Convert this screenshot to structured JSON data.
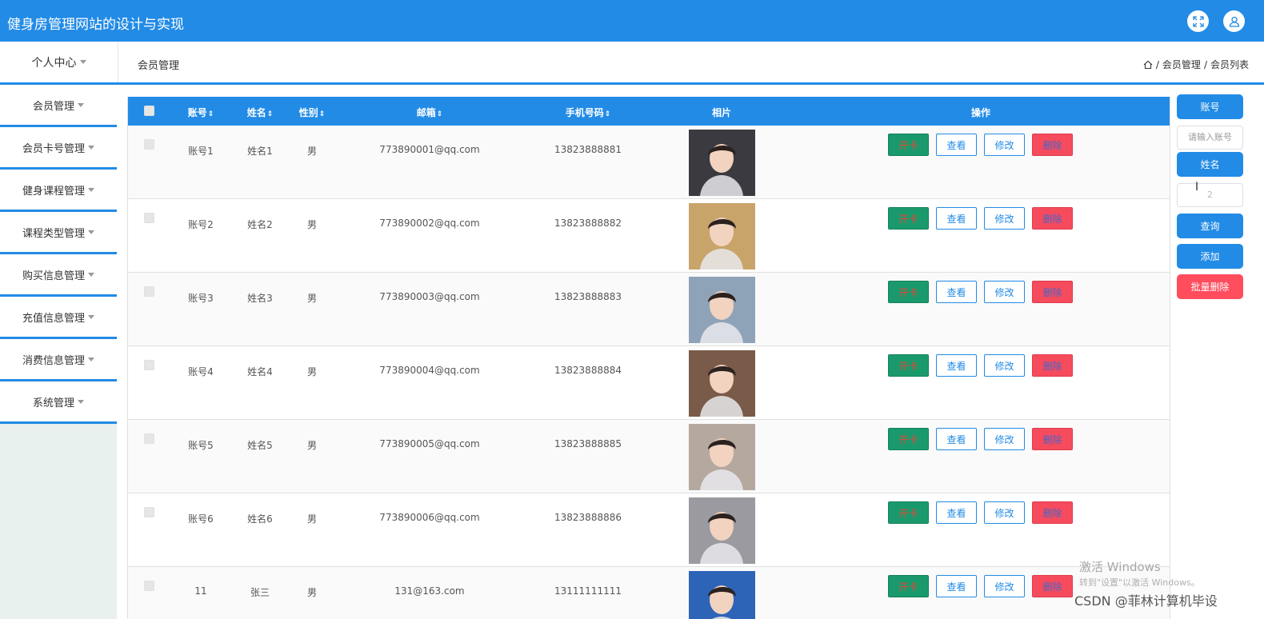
{
  "header": {
    "title": "健身房管理网站的设计与实现"
  },
  "nav": {
    "personal": "个人中心",
    "section": "会员管理",
    "breadcrumb": [
      "会员管理",
      "会员列表"
    ],
    "sep": "/"
  },
  "sidebar": {
    "items": [
      {
        "label": "会员管理"
      },
      {
        "label": "会员卡号管理"
      },
      {
        "label": "健身课程管理"
      },
      {
        "label": "课程类型管理"
      },
      {
        "label": "购买信息管理"
      },
      {
        "label": "充值信息管理"
      },
      {
        "label": "消费信息管理"
      },
      {
        "label": "系统管理"
      }
    ]
  },
  "table": {
    "headers": {
      "account": "账号",
      "name": "姓名",
      "gender": "性别",
      "email": "邮箱",
      "phone": "手机号码",
      "photo": "相片",
      "ops": "操作"
    },
    "actions": {
      "open": "开卡",
      "view": "查看",
      "edit": "修改",
      "del": "删除"
    },
    "rows": [
      {
        "account": "账号1",
        "name": "姓名1",
        "gender": "男",
        "email": "773890001@qq.com",
        "phone": "13823888881",
        "photo_color": "#3a3a40"
      },
      {
        "account": "账号2",
        "name": "姓名2",
        "gender": "男",
        "email": "773890002@qq.com",
        "phone": "13823888882",
        "photo_color": "#c9a46a"
      },
      {
        "account": "账号3",
        "name": "姓名3",
        "gender": "男",
        "email": "773890003@qq.com",
        "phone": "13823888883",
        "photo_color": "#8fa3b8"
      },
      {
        "account": "账号4",
        "name": "姓名4",
        "gender": "男",
        "email": "773890004@qq.com",
        "phone": "13823888884",
        "photo_color": "#7a5a48"
      },
      {
        "account": "账号5",
        "name": "姓名5",
        "gender": "男",
        "email": "773890005@qq.com",
        "phone": "13823888885",
        "photo_color": "#b5a89e"
      },
      {
        "account": "账号6",
        "name": "姓名6",
        "gender": "男",
        "email": "773890006@qq.com",
        "phone": "13823888886",
        "photo_color": "#9a9aa0"
      },
      {
        "account": "11",
        "name": "张三",
        "gender": "男",
        "email": "131@163.com",
        "phone": "13111111111",
        "photo_color": "#2e64b8"
      }
    ]
  },
  "search": {
    "account_label": "账号",
    "account_placeholder": "请输入账号",
    "name_label": "姓名",
    "name_value": "2",
    "query": "查询",
    "add": "添加",
    "batch_delete": "批量删除"
  },
  "overlay": {
    "watermark_title": "激活 Windows",
    "watermark_sub": "转到\"设置\"以激活 Windows。",
    "csdn": "CSDN @菲林计算机毕设"
  },
  "colors": {
    "primary": "#228be6",
    "danger": "#ff4d5e",
    "success": "#1a9a6c"
  }
}
